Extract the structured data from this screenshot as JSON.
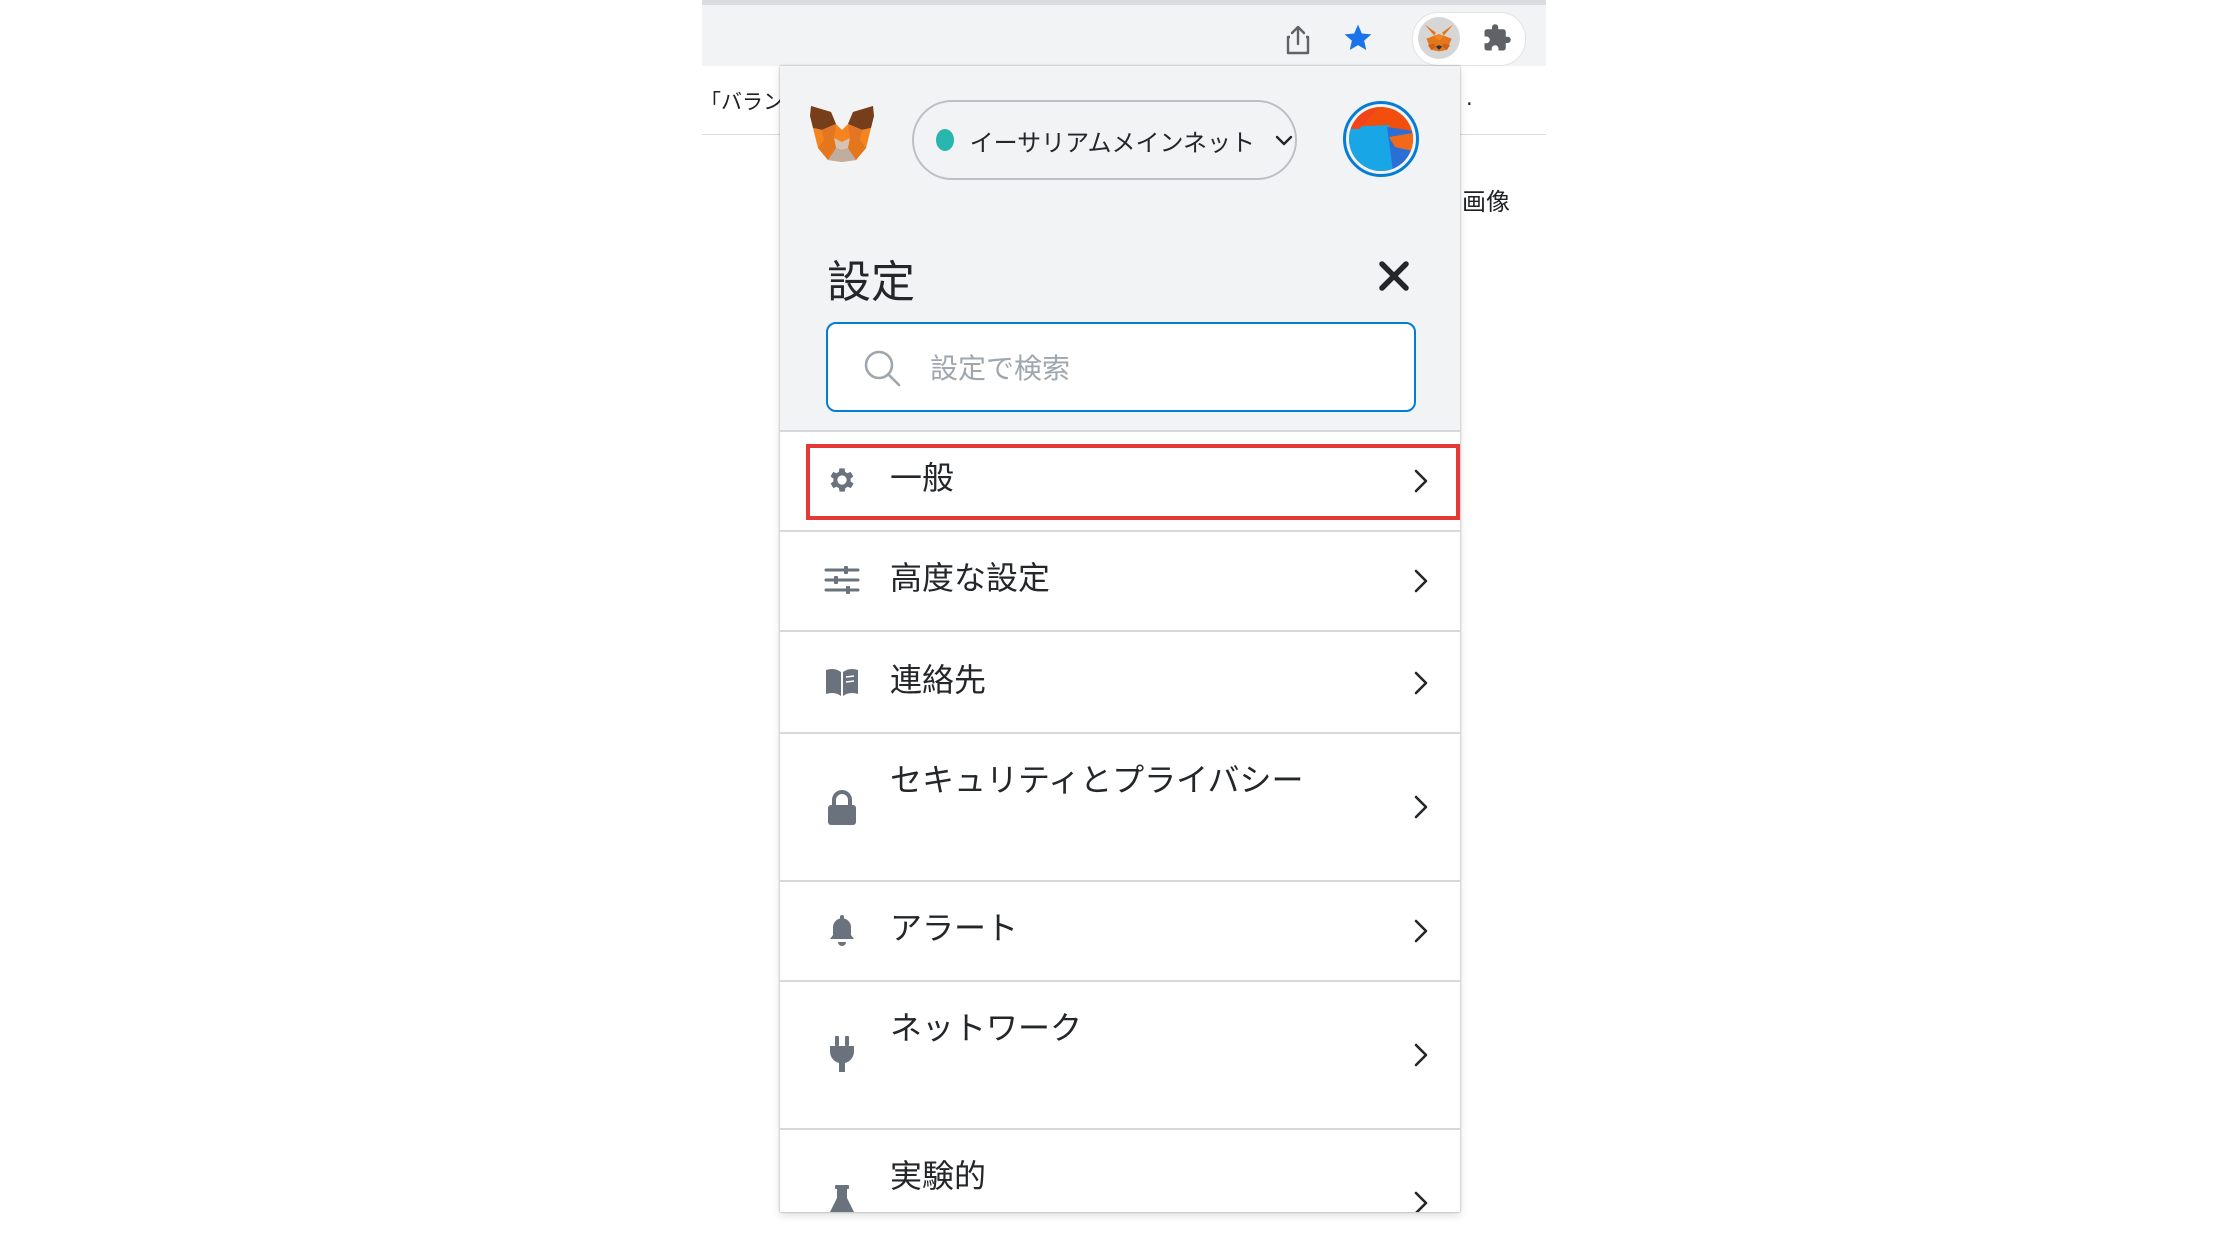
{
  "browser": {
    "bookmark_text": "「バラン",
    "bookmark_trailing": ".",
    "background_text": "画像",
    "icons": [
      "share-icon",
      "bookmark-star-icon",
      "metamask-fox-icon",
      "puzzle-extensions-icon"
    ],
    "star_color": "#1a73e8"
  },
  "popup": {
    "network": {
      "label": "イーサリアムメインネット",
      "dot_color": "#29b6af"
    },
    "title": "設定",
    "search": {
      "placeholder": "設定で検索",
      "value": ""
    },
    "accent_color": "#037dd6",
    "highlight_color": "#e53935",
    "menu": [
      {
        "label": "一般",
        "icon": "gear-icon",
        "highlighted": true
      },
      {
        "label": "高度な設定",
        "icon": "sliders-icon"
      },
      {
        "label": "連絡先",
        "icon": "book-icon"
      },
      {
        "label": "セキュリティとプライバシー",
        "icon": "lock-icon"
      },
      {
        "label": "アラート",
        "icon": "bell-icon"
      },
      {
        "label": "ネットワーク",
        "icon": "plug-icon"
      },
      {
        "label": "実験的",
        "icon": "flask-icon"
      }
    ]
  }
}
